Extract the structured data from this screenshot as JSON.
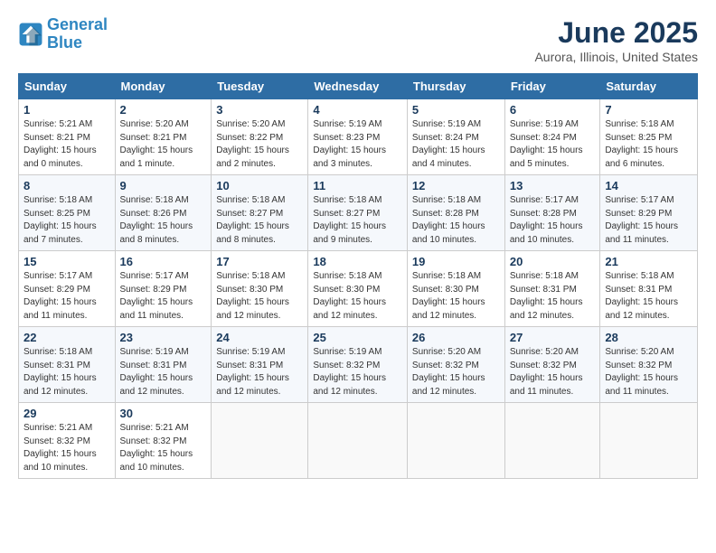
{
  "header": {
    "logo_line1": "General",
    "logo_line2": "Blue",
    "main_title": "June 2025",
    "subtitle": "Aurora, Illinois, United States"
  },
  "calendar": {
    "weekdays": [
      "Sunday",
      "Monday",
      "Tuesday",
      "Wednesday",
      "Thursday",
      "Friday",
      "Saturday"
    ],
    "weeks": [
      [
        {
          "day": "1",
          "sunrise": "5:21 AM",
          "sunset": "8:21 PM",
          "daylight": "15 hours and 0 minutes."
        },
        {
          "day": "2",
          "sunrise": "5:20 AM",
          "sunset": "8:21 PM",
          "daylight": "15 hours and 1 minute."
        },
        {
          "day": "3",
          "sunrise": "5:20 AM",
          "sunset": "8:22 PM",
          "daylight": "15 hours and 2 minutes."
        },
        {
          "day": "4",
          "sunrise": "5:19 AM",
          "sunset": "8:23 PM",
          "daylight": "15 hours and 3 minutes."
        },
        {
          "day": "5",
          "sunrise": "5:19 AM",
          "sunset": "8:24 PM",
          "daylight": "15 hours and 4 minutes."
        },
        {
          "day": "6",
          "sunrise": "5:19 AM",
          "sunset": "8:24 PM",
          "daylight": "15 hours and 5 minutes."
        },
        {
          "day": "7",
          "sunrise": "5:18 AM",
          "sunset": "8:25 PM",
          "daylight": "15 hours and 6 minutes."
        }
      ],
      [
        {
          "day": "8",
          "sunrise": "5:18 AM",
          "sunset": "8:25 PM",
          "daylight": "15 hours and 7 minutes."
        },
        {
          "day": "9",
          "sunrise": "5:18 AM",
          "sunset": "8:26 PM",
          "daylight": "15 hours and 8 minutes."
        },
        {
          "day": "10",
          "sunrise": "5:18 AM",
          "sunset": "8:27 PM",
          "daylight": "15 hours and 8 minutes."
        },
        {
          "day": "11",
          "sunrise": "5:18 AM",
          "sunset": "8:27 PM",
          "daylight": "15 hours and 9 minutes."
        },
        {
          "day": "12",
          "sunrise": "5:18 AM",
          "sunset": "8:28 PM",
          "daylight": "15 hours and 10 minutes."
        },
        {
          "day": "13",
          "sunrise": "5:17 AM",
          "sunset": "8:28 PM",
          "daylight": "15 hours and 10 minutes."
        },
        {
          "day": "14",
          "sunrise": "5:17 AM",
          "sunset": "8:29 PM",
          "daylight": "15 hours and 11 minutes."
        }
      ],
      [
        {
          "day": "15",
          "sunrise": "5:17 AM",
          "sunset": "8:29 PM",
          "daylight": "15 hours and 11 minutes."
        },
        {
          "day": "16",
          "sunrise": "5:17 AM",
          "sunset": "8:29 PM",
          "daylight": "15 hours and 11 minutes."
        },
        {
          "day": "17",
          "sunrise": "5:18 AM",
          "sunset": "8:30 PM",
          "daylight": "15 hours and 12 minutes."
        },
        {
          "day": "18",
          "sunrise": "5:18 AM",
          "sunset": "8:30 PM",
          "daylight": "15 hours and 12 minutes."
        },
        {
          "day": "19",
          "sunrise": "5:18 AM",
          "sunset": "8:30 PM",
          "daylight": "15 hours and 12 minutes."
        },
        {
          "day": "20",
          "sunrise": "5:18 AM",
          "sunset": "8:31 PM",
          "daylight": "15 hours and 12 minutes."
        },
        {
          "day": "21",
          "sunrise": "5:18 AM",
          "sunset": "8:31 PM",
          "daylight": "15 hours and 12 minutes."
        }
      ],
      [
        {
          "day": "22",
          "sunrise": "5:18 AM",
          "sunset": "8:31 PM",
          "daylight": "15 hours and 12 minutes."
        },
        {
          "day": "23",
          "sunrise": "5:19 AM",
          "sunset": "8:31 PM",
          "daylight": "15 hours and 12 minutes."
        },
        {
          "day": "24",
          "sunrise": "5:19 AM",
          "sunset": "8:31 PM",
          "daylight": "15 hours and 12 minutes."
        },
        {
          "day": "25",
          "sunrise": "5:19 AM",
          "sunset": "8:32 PM",
          "daylight": "15 hours and 12 minutes."
        },
        {
          "day": "26",
          "sunrise": "5:20 AM",
          "sunset": "8:32 PM",
          "daylight": "15 hours and 12 minutes."
        },
        {
          "day": "27",
          "sunrise": "5:20 AM",
          "sunset": "8:32 PM",
          "daylight": "15 hours and 11 minutes."
        },
        {
          "day": "28",
          "sunrise": "5:20 AM",
          "sunset": "8:32 PM",
          "daylight": "15 hours and 11 minutes."
        }
      ],
      [
        {
          "day": "29",
          "sunrise": "5:21 AM",
          "sunset": "8:32 PM",
          "daylight": "15 hours and 10 minutes."
        },
        {
          "day": "30",
          "sunrise": "5:21 AM",
          "sunset": "8:32 PM",
          "daylight": "15 hours and 10 minutes."
        },
        null,
        null,
        null,
        null,
        null
      ]
    ]
  }
}
